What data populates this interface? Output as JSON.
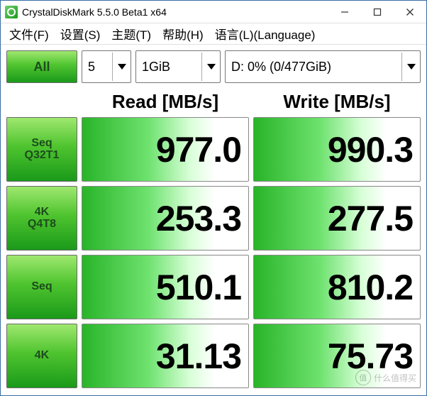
{
  "titlebar": {
    "title": "CrystalDiskMark 5.5.0 Beta1 x64"
  },
  "menu": {
    "file": "文件(F)",
    "settings": "设置(S)",
    "theme": "主题(T)",
    "help": "帮助(H)",
    "language": "语言(L)(Language)"
  },
  "controls": {
    "all_label": "All",
    "runs": "5",
    "size": "1GiB",
    "drive": "D: 0% (0/477GiB)"
  },
  "columns": {
    "read": "Read [MB/s]",
    "write": "Write [MB/s]"
  },
  "tests": [
    {
      "label_line1": "Seq",
      "label_line2": "Q32T1",
      "read": "977.0",
      "write": "990.3"
    },
    {
      "label_line1": "4K",
      "label_line2": "Q4T8",
      "read": "253.3",
      "write": "277.5"
    },
    {
      "label_line1": "Seq",
      "label_line2": "",
      "read": "510.1",
      "write": "810.2"
    },
    {
      "label_line1": "4K",
      "label_line2": "",
      "read": "31.13",
      "write": "75.73"
    }
  ],
  "watermark": {
    "brand": "值",
    "text": "什么值得买"
  }
}
